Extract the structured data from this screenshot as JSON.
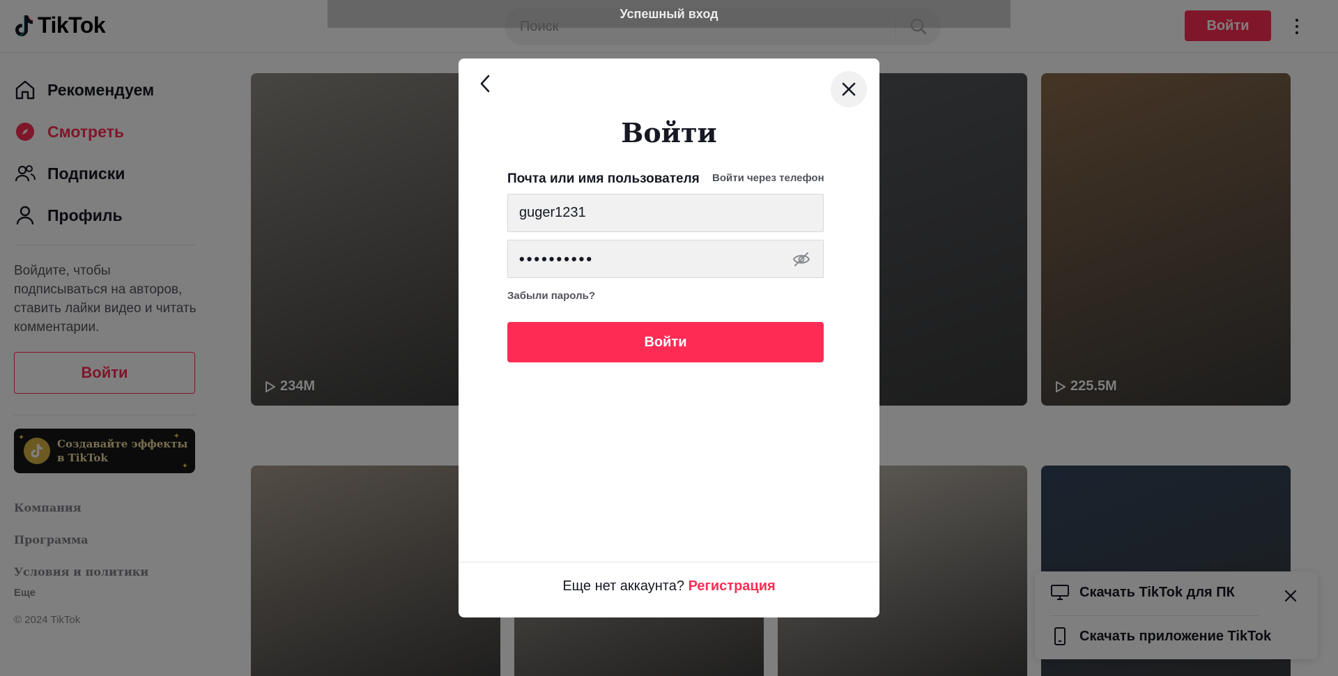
{
  "header": {
    "logo_text": "TikTok",
    "search_placeholder": "Поиск",
    "login_label": "Войти"
  },
  "sidebar": {
    "nav": [
      {
        "label": "Рекомендуем",
        "icon": "home-icon",
        "active": false
      },
      {
        "label": "Смотреть",
        "icon": "compass-icon",
        "active": true
      },
      {
        "label": "Подписки",
        "icon": "following-icon",
        "active": false
      },
      {
        "label": "Профиль",
        "icon": "profile-icon",
        "active": false
      }
    ],
    "note": "Войдите, чтобы подписываться на авторов, ставить лайки видео и читать комментарии.",
    "login_label": "Войти",
    "effects_banner": "Создавайте эффекты в TikTok",
    "footer_links": [
      "Компания",
      "Программа",
      "Условия и политики"
    ],
    "more_label": "Еще",
    "copyright": "© 2024 TikTok"
  },
  "grid": {
    "videos": [
      {
        "views": "234M",
        "bg": "#8f8a83"
      },
      {
        "views": "",
        "bg": "#6f6a64"
      },
      {
        "views": "",
        "bg": "#55585d"
      },
      {
        "views": "225.5M",
        "bg": "#8a6a4c"
      },
      {
        "views": "",
        "bg": "#a69a8c"
      },
      {
        "views": "",
        "bg": "#b8ada2"
      },
      {
        "views": "",
        "bg": "#c4bcb1"
      },
      {
        "views": "",
        "bg": "#33465e"
      }
    ]
  },
  "download_panel": {
    "desktop_label": "Скачать TikTok для ПК",
    "app_label": "Скачать приложение TikTok"
  },
  "toast": {
    "text": "Успешный вход"
  },
  "login_modal": {
    "title": "Войти",
    "field_label": "Почта или имя пользователя",
    "phone_link": "Войти через телефон",
    "username_value": "guger1231",
    "password_mask": "••••••••••",
    "forgot_label": "Забыли пароль?",
    "submit_label": "Войти",
    "footer_text": "Еще нет аккаунта?",
    "signup_label": "Регистрация"
  },
  "colors": {
    "accent": "#fe2c55",
    "text": "#161823"
  }
}
